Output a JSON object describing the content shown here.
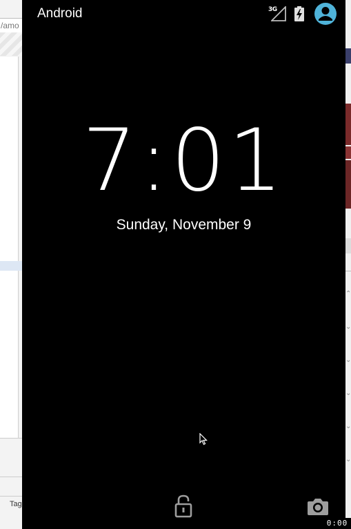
{
  "background_left": {
    "url_fragment": "/amo",
    "tag_fragment": "Tag"
  },
  "status_bar": {
    "carrier": "Android",
    "network_type": "3G",
    "icons": [
      "signal-icon",
      "battery-charging-icon",
      "user-avatar-icon"
    ],
    "avatar_color": "#4fb3d9"
  },
  "lockscreen": {
    "time": "7:01",
    "date": "Sunday, November 9",
    "bottom_icons": [
      "unlock-icon",
      "camera-icon"
    ]
  },
  "recording": {
    "timer": "0:00"
  },
  "colors": {
    "screen_bg": "#000000",
    "text": "#ffffff",
    "icon_gray": "#9e9e9e"
  }
}
